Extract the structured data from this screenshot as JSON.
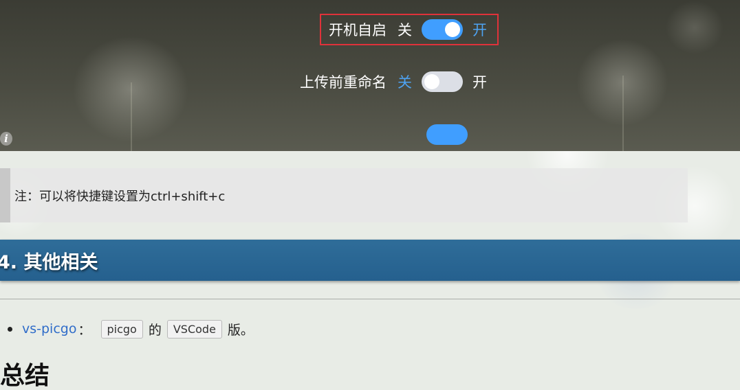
{
  "settings_panel": {
    "rows": [
      {
        "label": "开机自启",
        "off_text": "关",
        "on_text": "开",
        "state": "on"
      },
      {
        "label": "上传前重命名",
        "off_text": "关",
        "on_text": "开",
        "state": "off"
      }
    ]
  },
  "info_icon": {
    "glyph": "i",
    "name": "info-icon"
  },
  "note": {
    "text": "注：可以将快捷键设置为ctrl+shift+c"
  },
  "section": {
    "heading": "4. 其他相关"
  },
  "list": {
    "items": [
      {
        "link_text": "vs-picgo",
        "sep": "：",
        "code1": "picgo",
        "mid": "的",
        "code2": "VSCode",
        "end": "版。"
      }
    ]
  },
  "next_heading": "总结",
  "colors": {
    "toggle_on": "#409eff",
    "toggle_off": "#dcdfe6",
    "highlight_border": "#e0323a",
    "section_bar": "#2f6d99",
    "link": "#2f6cc9"
  }
}
